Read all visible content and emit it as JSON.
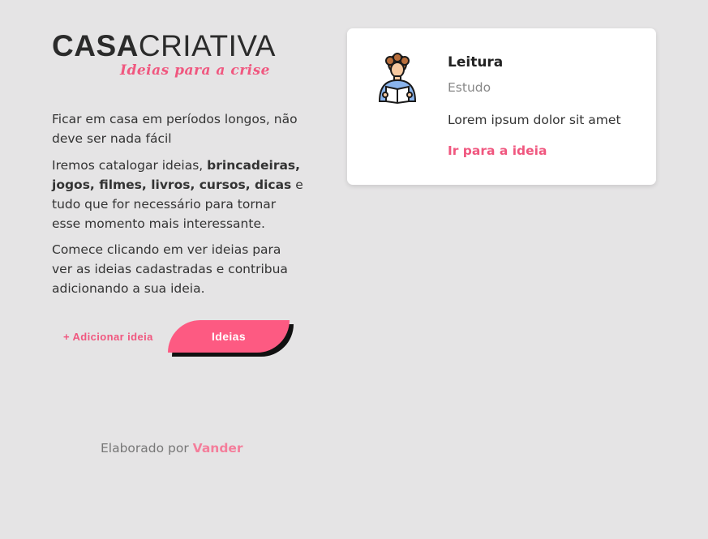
{
  "logo": {
    "bold": "CASA",
    "light": "CRIATIVA",
    "tagline": "Ideias para a crise"
  },
  "intro": {
    "p1": "Ficar em casa em períodos longos, não deve ser nada fácil",
    "p2_start": "Iremos catalogar ideias, ",
    "p2_bold": "brincadeiras, jogos, filmes, livros, cursos, dicas",
    "p2_end": " e tudo que for necessário para tornar esse momento mais interessante.",
    "p3": "Comece clicando em ver ideias para ver as ideias cadastradas e contribua adicionando a sua ideia."
  },
  "actions": {
    "add_label": "+ Adicionar ideia",
    "ideas_label": "Ideias"
  },
  "footer": {
    "prefix": "Elaborado por ",
    "author": "Vander"
  },
  "card": {
    "icon": "reading-person-icon",
    "title": "Leitura",
    "category": "Estudo",
    "description": "Lorem ipsum dolor sit amet",
    "link_label": "Ir para a ideia"
  },
  "colors": {
    "accent": "#fd5a82",
    "background": "#e5e4e5"
  }
}
